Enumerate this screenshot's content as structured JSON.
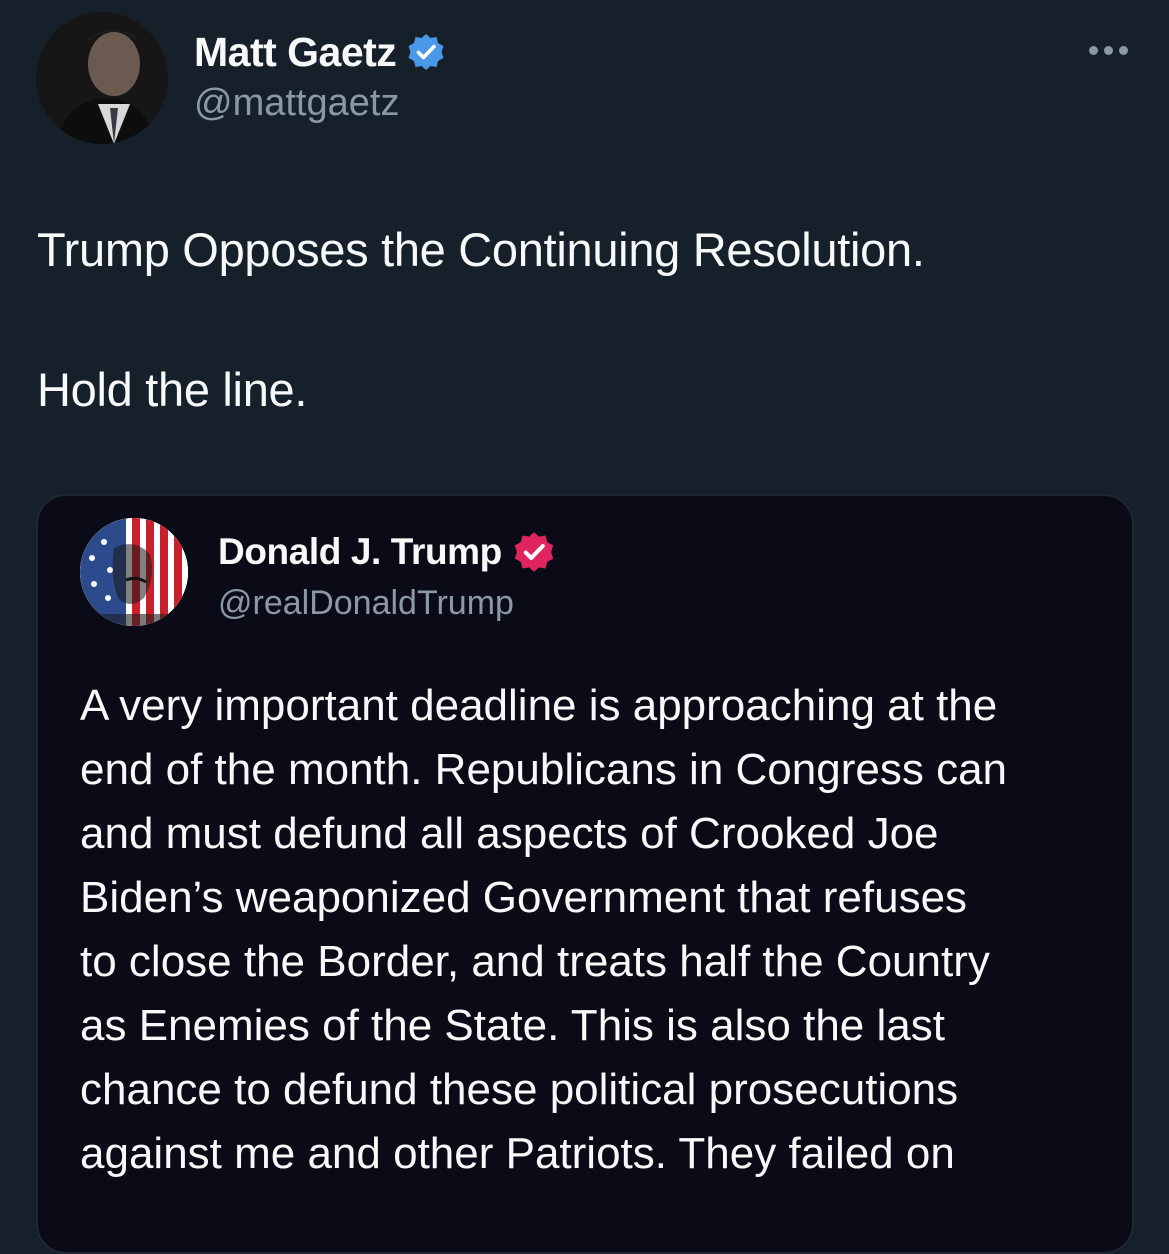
{
  "tweet": {
    "author": {
      "name": "Matt Gaetz",
      "handle": "@mattgaetz",
      "verified_color": "#4a99e9"
    },
    "text_lines": [
      "Trump Opposes the Continuing Resolution.",
      "Hold the line."
    ],
    "more_icon": "more-horizontal-icon"
  },
  "quoted_tweet": {
    "author": {
      "name": "Donald J. Trump",
      "handle": "@realDonaldTrump",
      "verified_color": "#e0245e"
    },
    "text_lines": [
      "A very important deadline is approaching at the",
      "end of the month. Republicans in Congress can",
      "and must defund all aspects of Crooked Joe",
      "Biden’s weaponized Government that refuses",
      "to close the Border, and treats half the Country",
      "as Enemies of the State. This is also the last",
      "chance to defund these political prosecutions",
      "against me and other Patriots. They failed on"
    ]
  },
  "colors": {
    "background": "#15202b",
    "quote_background": "#0b0b18",
    "primary_text": "#f7f9f9",
    "secondary_text": "#8b98a5"
  }
}
